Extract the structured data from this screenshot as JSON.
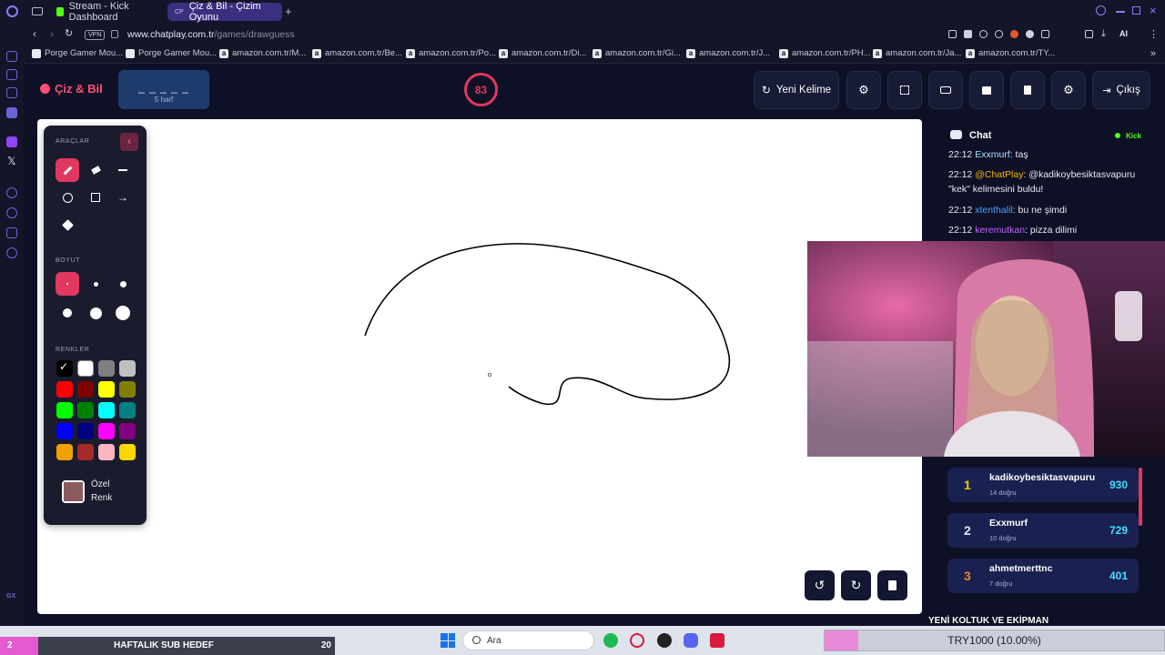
{
  "browser": {
    "tabs": [
      {
        "label": "Stream - Kick Dashboard",
        "active": false
      },
      {
        "label": "Çiz & Bil - Çizim Oyunu",
        "active": true
      }
    ],
    "vpn_badge": "VPN",
    "url_host": "www.chatplay.com.tr",
    "url_path": "/games/drawguess",
    "ai_label": "AI",
    "bookmarks": [
      "Porge Gamer Mou...",
      "Porge Gamer Mou...",
      "amazon.com.tr/M...",
      "amazon.com.tr/Be...",
      "amazon.com.tr/Po...",
      "amazon.com.tr/Di...",
      "amazon.com.tr/Gi...",
      "amazon.com.tr/J...",
      "amazon.com.tr/PH...",
      "amazon.com.tr/Ja...",
      "amazon.com.tr/TY..."
    ]
  },
  "app": {
    "logo": "Çiz & Bil",
    "word_mask": "_ _ _ _ _",
    "word_hint": "5 harf",
    "timer": "83",
    "new_word_label": "Yeni Kelime",
    "exit_label": "Çıkış"
  },
  "tools": {
    "tools_title": "ARAÇLAR",
    "size_title": "BOYUT",
    "colors_title": "RENKLER",
    "custom_color_line1": "Özel",
    "custom_color_line2": "Renk",
    "custom_color": "#8b5a5f",
    "palette": [
      "#000000",
      "#ffffff",
      "#808080",
      "#c0c0c0",
      "#ff0000",
      "#800000",
      "#ffff00",
      "#808000",
      "#00ff00",
      "#008000",
      "#00ffff",
      "#008080",
      "#0000ff",
      "#000080",
      "#ff00ff",
      "#800080",
      "#f0a000",
      "#a52a2a",
      "#ffb6c1",
      "#ffd700"
    ]
  },
  "chat": {
    "title": "Chat",
    "platform": "Kick",
    "messages": [
      {
        "time": "22:12",
        "user": "Exxmurf",
        "sep": ":",
        "text": " taş",
        "color": "#a8e0ff"
      },
      {
        "time": "22:12",
        "user": "@ChatPlay",
        "sep": ":",
        "text": " @kadikoybesiktasvapuru \"kek\" kelimesini buldu!",
        "color": "#f5b400"
      },
      {
        "time": "22:12",
        "user": "xtenthalil",
        "sep": ":",
        "text": " bu ne şimdi",
        "color": "#4aa3ff"
      },
      {
        "time": "22:12",
        "user": "keremutkan",
        "sep": ":",
        "text": " pizza dilimi",
        "color": "#c060ff"
      }
    ]
  },
  "leaderboard": [
    {
      "rank": "1",
      "name": "kadikoybesiktasvapuru",
      "sub": "14 doğru",
      "score": "930",
      "rank_color": "#f5c400"
    },
    {
      "rank": "2",
      "name": "Exxmurf",
      "sub": "10 doğru",
      "score": "729",
      "rank_color": "#dfe3ee"
    },
    {
      "rank": "3",
      "name": "ahmetmerttnc",
      "sub": "7 doğru",
      "score": "401",
      "rank_color": "#e08a2a"
    }
  ],
  "banner": "YENİ KOLTUK VE EKİPMAN",
  "bottom": {
    "sub_goal_left": "2",
    "sub_goal_label": "HAFTALIK SUB HEDEF",
    "sub_goal_right": "20",
    "search_placeholder": "Ara",
    "donation_label": "TRY1000 (10.00%)",
    "donation_progress": 0.1
  },
  "colors": {
    "accent": "#e0385e",
    "score": "#3ee0ff"
  }
}
